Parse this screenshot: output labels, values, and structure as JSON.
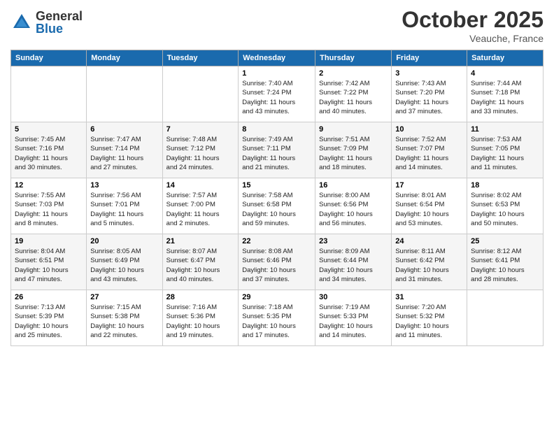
{
  "header": {
    "logo_general": "General",
    "logo_blue": "Blue",
    "month": "October 2025",
    "location": "Veauche, France"
  },
  "weekdays": [
    "Sunday",
    "Monday",
    "Tuesday",
    "Wednesday",
    "Thursday",
    "Friday",
    "Saturday"
  ],
  "weeks": [
    [
      {
        "day": "",
        "info": ""
      },
      {
        "day": "",
        "info": ""
      },
      {
        "day": "",
        "info": ""
      },
      {
        "day": "1",
        "info": "Sunrise: 7:40 AM\nSunset: 7:24 PM\nDaylight: 11 hours\nand 43 minutes."
      },
      {
        "day": "2",
        "info": "Sunrise: 7:42 AM\nSunset: 7:22 PM\nDaylight: 11 hours\nand 40 minutes."
      },
      {
        "day": "3",
        "info": "Sunrise: 7:43 AM\nSunset: 7:20 PM\nDaylight: 11 hours\nand 37 minutes."
      },
      {
        "day": "4",
        "info": "Sunrise: 7:44 AM\nSunset: 7:18 PM\nDaylight: 11 hours\nand 33 minutes."
      }
    ],
    [
      {
        "day": "5",
        "info": "Sunrise: 7:45 AM\nSunset: 7:16 PM\nDaylight: 11 hours\nand 30 minutes."
      },
      {
        "day": "6",
        "info": "Sunrise: 7:47 AM\nSunset: 7:14 PM\nDaylight: 11 hours\nand 27 minutes."
      },
      {
        "day": "7",
        "info": "Sunrise: 7:48 AM\nSunset: 7:12 PM\nDaylight: 11 hours\nand 24 minutes."
      },
      {
        "day": "8",
        "info": "Sunrise: 7:49 AM\nSunset: 7:11 PM\nDaylight: 11 hours\nand 21 minutes."
      },
      {
        "day": "9",
        "info": "Sunrise: 7:51 AM\nSunset: 7:09 PM\nDaylight: 11 hours\nand 18 minutes."
      },
      {
        "day": "10",
        "info": "Sunrise: 7:52 AM\nSunset: 7:07 PM\nDaylight: 11 hours\nand 14 minutes."
      },
      {
        "day": "11",
        "info": "Sunrise: 7:53 AM\nSunset: 7:05 PM\nDaylight: 11 hours\nand 11 minutes."
      }
    ],
    [
      {
        "day": "12",
        "info": "Sunrise: 7:55 AM\nSunset: 7:03 PM\nDaylight: 11 hours\nand 8 minutes."
      },
      {
        "day": "13",
        "info": "Sunrise: 7:56 AM\nSunset: 7:01 PM\nDaylight: 11 hours\nand 5 minutes."
      },
      {
        "day": "14",
        "info": "Sunrise: 7:57 AM\nSunset: 7:00 PM\nDaylight: 11 hours\nand 2 minutes."
      },
      {
        "day": "15",
        "info": "Sunrise: 7:58 AM\nSunset: 6:58 PM\nDaylight: 10 hours\nand 59 minutes."
      },
      {
        "day": "16",
        "info": "Sunrise: 8:00 AM\nSunset: 6:56 PM\nDaylight: 10 hours\nand 56 minutes."
      },
      {
        "day": "17",
        "info": "Sunrise: 8:01 AM\nSunset: 6:54 PM\nDaylight: 10 hours\nand 53 minutes."
      },
      {
        "day": "18",
        "info": "Sunrise: 8:02 AM\nSunset: 6:53 PM\nDaylight: 10 hours\nand 50 minutes."
      }
    ],
    [
      {
        "day": "19",
        "info": "Sunrise: 8:04 AM\nSunset: 6:51 PM\nDaylight: 10 hours\nand 47 minutes."
      },
      {
        "day": "20",
        "info": "Sunrise: 8:05 AM\nSunset: 6:49 PM\nDaylight: 10 hours\nand 43 minutes."
      },
      {
        "day": "21",
        "info": "Sunrise: 8:07 AM\nSunset: 6:47 PM\nDaylight: 10 hours\nand 40 minutes."
      },
      {
        "day": "22",
        "info": "Sunrise: 8:08 AM\nSunset: 6:46 PM\nDaylight: 10 hours\nand 37 minutes."
      },
      {
        "day": "23",
        "info": "Sunrise: 8:09 AM\nSunset: 6:44 PM\nDaylight: 10 hours\nand 34 minutes."
      },
      {
        "day": "24",
        "info": "Sunrise: 8:11 AM\nSunset: 6:42 PM\nDaylight: 10 hours\nand 31 minutes."
      },
      {
        "day": "25",
        "info": "Sunrise: 8:12 AM\nSunset: 6:41 PM\nDaylight: 10 hours\nand 28 minutes."
      }
    ],
    [
      {
        "day": "26",
        "info": "Sunrise: 7:13 AM\nSunset: 5:39 PM\nDaylight: 10 hours\nand 25 minutes."
      },
      {
        "day": "27",
        "info": "Sunrise: 7:15 AM\nSunset: 5:38 PM\nDaylight: 10 hours\nand 22 minutes."
      },
      {
        "day": "28",
        "info": "Sunrise: 7:16 AM\nSunset: 5:36 PM\nDaylight: 10 hours\nand 19 minutes."
      },
      {
        "day": "29",
        "info": "Sunrise: 7:18 AM\nSunset: 5:35 PM\nDaylight: 10 hours\nand 17 minutes."
      },
      {
        "day": "30",
        "info": "Sunrise: 7:19 AM\nSunset: 5:33 PM\nDaylight: 10 hours\nand 14 minutes."
      },
      {
        "day": "31",
        "info": "Sunrise: 7:20 AM\nSunset: 5:32 PM\nDaylight: 10 hours\nand 11 minutes."
      },
      {
        "day": "",
        "info": ""
      }
    ]
  ]
}
